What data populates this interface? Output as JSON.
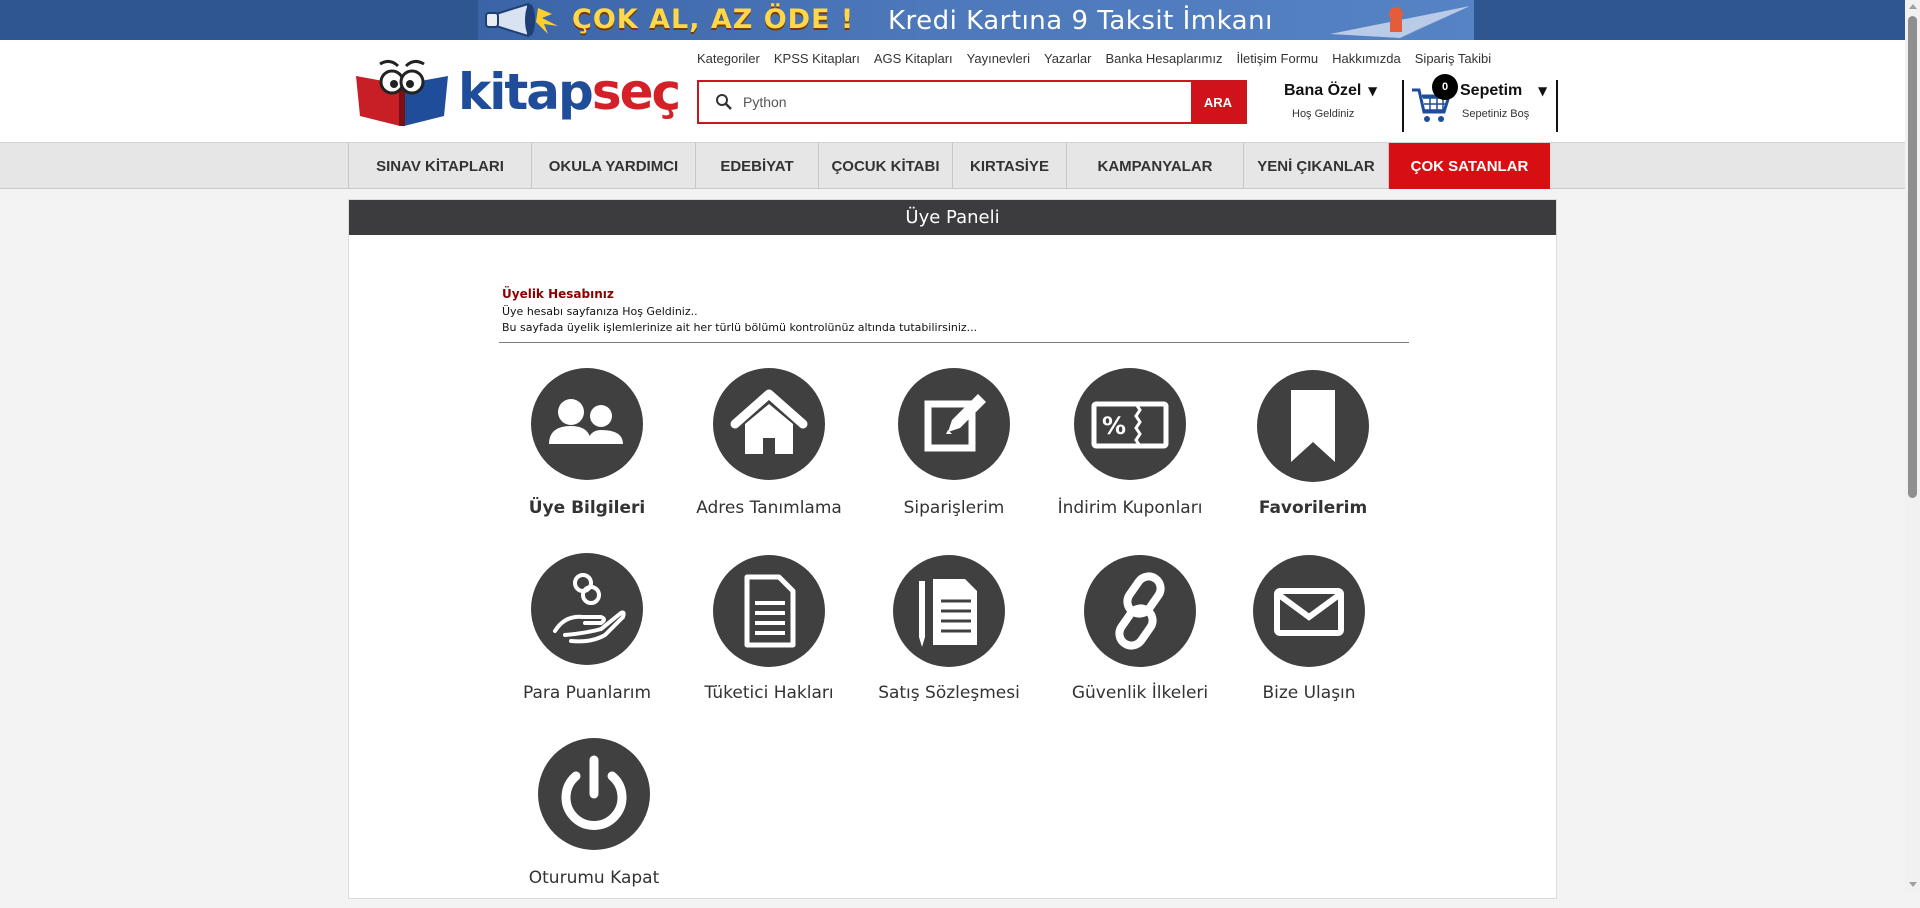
{
  "banner": {
    "left_text": "ÇOK AL, AZ ÖDE !",
    "right_text": "Kredi Kartına 9 Taksit İmkanı"
  },
  "logo": {
    "part1": "kitap",
    "part2": "seç"
  },
  "top_links": [
    "Kategoriler",
    "KPSS Kitapları",
    "AGS Kitapları",
    "Yayınevleri",
    "Yazarlar",
    "Banka Hesaplarımız",
    "İletişim Formu",
    "Hakkımızda",
    "Sipariş Takibi"
  ],
  "search": {
    "value": "Python",
    "button": "ARA"
  },
  "account": {
    "title": "Bana Özel",
    "subtitle": "Hoş Geldiniz"
  },
  "cart": {
    "count": "0",
    "title": "Sepetim",
    "subtitle": "Sepetiniz Boş"
  },
  "nav": [
    "SINAV KİTAPLARI",
    "OKULA YARDIMCI",
    "EDEBİYAT",
    "ÇOCUK KİTABI",
    "KIRTASİYE",
    "KAMPANYALAR",
    "YENİ ÇIKANLAR",
    "ÇOK SATANLAR"
  ],
  "panel": {
    "title": "Üye Paneli",
    "account_heading": "Üyelik Hesabınız",
    "line1": "Üye hesabı sayfanıza Hoş Geldiniz..",
    "line2": "Bu sayfada üyelik işlemlerinize ait her türlü bölümü kontrolünüz altında tutabilirsiniz..."
  },
  "tiles": [
    {
      "label": "Üye Bilgileri",
      "icon": "users-icon"
    },
    {
      "label": "Adres Tanımlama",
      "icon": "home-icon"
    },
    {
      "label": "Siparişlerim",
      "icon": "edit-icon"
    },
    {
      "label": "İndirim Kuponları",
      "icon": "coupon-icon"
    },
    {
      "label": "Favorilerim",
      "icon": "bookmark-icon"
    },
    {
      "label": "Para Puanlarım",
      "icon": "coins-hand-icon"
    },
    {
      "label": "Tüketici Hakları",
      "icon": "document-icon"
    },
    {
      "label": "Satış Sözleşmesi",
      "icon": "contract-icon"
    },
    {
      "label": "Güvenlik İlkeleri",
      "icon": "link-icon"
    },
    {
      "label": "Bize Ulaşın",
      "icon": "envelope-icon"
    },
    {
      "label": "Oturumu Kapat",
      "icon": "power-icon"
    }
  ]
}
